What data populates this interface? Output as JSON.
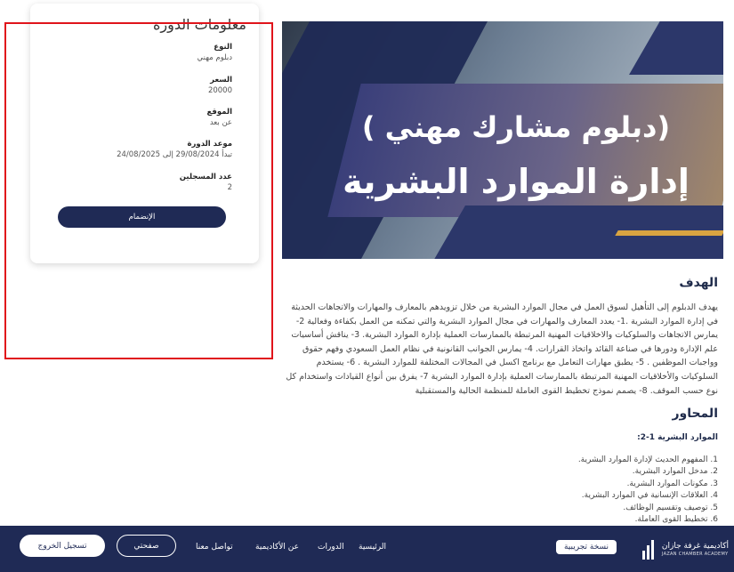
{
  "banner": {
    "line1": "(دبلوم مشارك مهني )",
    "line2": "إدارة الموارد البشرية"
  },
  "goal": {
    "title": "الهدف",
    "text": "يهدف الدبلوم إلى التأهيل لسوق العمل في مجال الموارد البشرية من خلال تزويدهم بالمعارف والمهارات والاتجاهات الحديثة في إدارة الموارد البشرية .1- يعدد المعارف والمهارات في مجال الموارد البشرية والتي تمكنه من العمل بكفاءة وفعالية 2- يمارس الاتجاهات والسلوكيات والاخلاقيات المهنية المرتبطة بالممارسات العملية بإدارة الموارد البشرية. 3- يناقش أساسيات علم الإدارة ودورها في صناعة القائد واتخاذ القرارات. 4- يمارس الجوانب القانونية في نظام العمل السعودي وفهم حقوق وواجبات الموظفين . 5- يطبق مهارات التعامل مع برنامج اكسل في المجالات المختلفة للموارد البشرية . 6- يستخدم السلوكيات والأخلاقيات المهنية المرتبطة بالممارسات العملية بإدارة الموارد البشرية 7- يفرق بين أنواع القيادات واستخدام كل نوع حسب الموقف. 8- يصمم نموذج تخطيط القوى العاملة للمنظمة الحالية والمستقبلية"
  },
  "axes": {
    "title": "المحاور",
    "subtitle": "الموارد البشرية 1-2:",
    "items": [
      "1. المفهوم الحديث لإدارة الموارد البشرية.",
      "2. مدخل الموارد البشرية.",
      "3. مكونات الموارد البشرية.",
      "4. العلاقات الإنسانية في الموارد البشرية.",
      "5. توصيف وتقسيم الوظائف.",
      "6. تخطيط القوى العاملة."
    ]
  },
  "info": {
    "title": "معلومات الدورة",
    "type_label": "النوع",
    "type_value": "دبلوم مهني",
    "price_label": "السعر",
    "price_value": "20000",
    "location_label": "الموقع",
    "location_value": "عن بعد",
    "date_label": "موعد الدورة",
    "date_value": "تبدأ 29/08/2024 إلى 24/08/2025",
    "enrolled_label": "عدد المسجلين",
    "enrolled_value": "2",
    "join_label": "الإنضمام"
  },
  "footer": {
    "brand_ar": "أكاديمية غرفة جازان",
    "brand_en": "JAZAN CHAMBER ACADEMY",
    "trial_label": "نسخة تجريبية",
    "nav_home": "الرئيسية",
    "nav_courses": "الدورات",
    "nav_about": "عن الأكاديمية",
    "nav_contact": "تواصل معنا",
    "my_page": "صفحتي",
    "logout": "تسجيل الخروج"
  },
  "colors": {
    "navy": "#1f2a55",
    "highlight": "#e0141b",
    "gold": "#d9a441"
  }
}
